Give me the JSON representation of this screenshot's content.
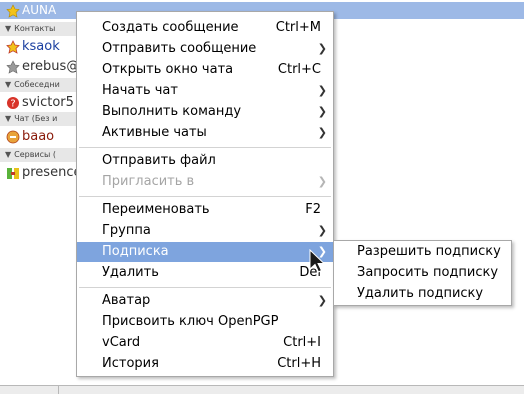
{
  "roster": {
    "selected_name": "AUNA",
    "groups": [
      {
        "label": "Контакты"
      },
      {
        "label": "Собеседни"
      },
      {
        "label": "Чат (Без и"
      },
      {
        "label": "Сервисы ("
      }
    ],
    "contacts": [
      {
        "name": "ksaok"
      },
      {
        "name": "erebus@"
      },
      {
        "name": "svictor5"
      },
      {
        "name": "baao"
      },
      {
        "name": "presence"
      }
    ]
  },
  "context_menu": {
    "items": [
      {
        "label": "Создать сообщение",
        "shortcut": "Ctrl+M"
      },
      {
        "label": "Отправить сообщение"
      },
      {
        "label": "Открыть окно чата",
        "shortcut": "Ctrl+C"
      },
      {
        "label": "Начать чат"
      },
      {
        "label": "Выполнить команду"
      },
      {
        "label": "Активные чаты"
      },
      {
        "label": "Отправить файл"
      },
      {
        "label": "Пригласить в"
      },
      {
        "label": "Переименовать",
        "shortcut": "F2"
      },
      {
        "label": "Группа"
      },
      {
        "label": "Подписка"
      },
      {
        "label": "Удалить",
        "shortcut": "Del"
      },
      {
        "label": "Аватар"
      },
      {
        "label": "Присвоить ключ OpenPGP"
      },
      {
        "label": "vCard",
        "shortcut": "Ctrl+I"
      },
      {
        "label": "История",
        "shortcut": "Ctrl+H"
      }
    ]
  },
  "subscription_menu": {
    "items": [
      {
        "label": "Разрешить подписку"
      },
      {
        "label": "Запросить подписку"
      },
      {
        "label": "Удалить подписку"
      }
    ]
  },
  "colors": {
    "highlight": "#7ea4de",
    "selected_row": "#9db9e6",
    "group_bg": "#e7e7e7",
    "disabled_text": "#a5a5a5"
  }
}
